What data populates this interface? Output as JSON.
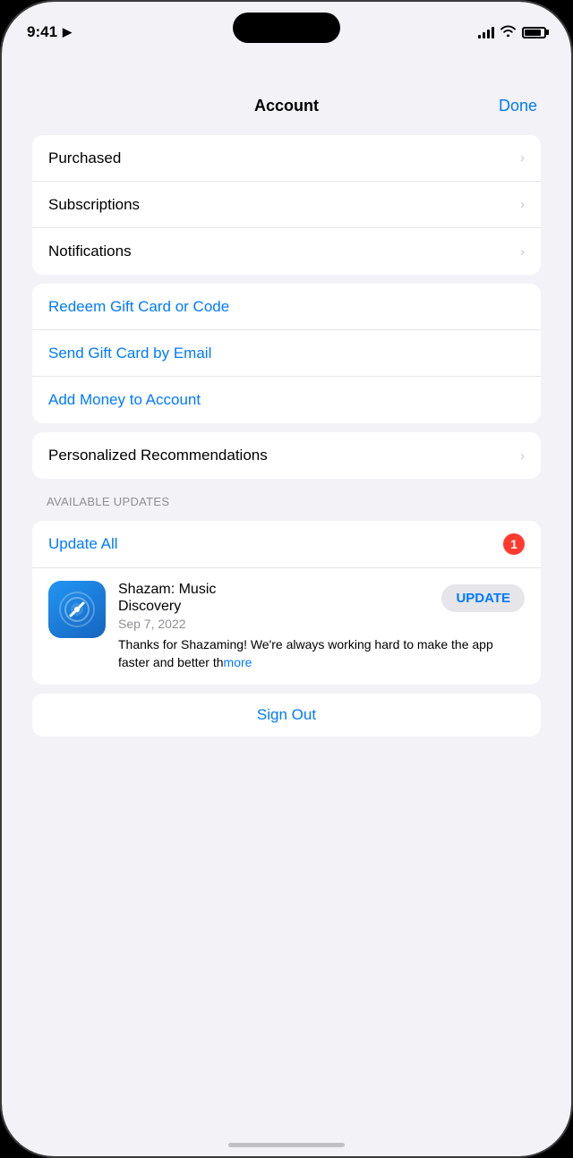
{
  "statusBar": {
    "time": "9:41",
    "locationArrow": true
  },
  "modal": {
    "title": "Account",
    "doneButton": "Done"
  },
  "firstSection": {
    "items": [
      {
        "label": "Purchased",
        "hasChevron": true
      },
      {
        "label": "Subscriptions",
        "hasChevron": true
      },
      {
        "label": "Notifications",
        "hasChevron": true
      }
    ]
  },
  "giftSection": {
    "items": [
      {
        "label": "Redeem Gift Card or Code",
        "isBlue": true
      },
      {
        "label": "Send Gift Card by Email",
        "isBlue": true
      },
      {
        "label": "Add Money to Account",
        "isBlue": true
      }
    ]
  },
  "recommendationsSection": {
    "items": [
      {
        "label": "Personalized Recommendations",
        "hasChevron": true
      }
    ]
  },
  "updatesSection": {
    "sectionHeader": "AVAILABLE UPDATES",
    "updateAllLabel": "Update All",
    "badgeCount": "1",
    "app": {
      "name": "Shazam: Music\nDiscovery",
      "date": "Sep 7, 2022",
      "description": "Thanks for Shazaming! We're always working hard to make the app faster and better th",
      "descriptionMore": "more",
      "updateButtonLabel": "UPDATE"
    }
  },
  "signOut": {
    "label": "Sign Out"
  },
  "homeIndicator": ""
}
